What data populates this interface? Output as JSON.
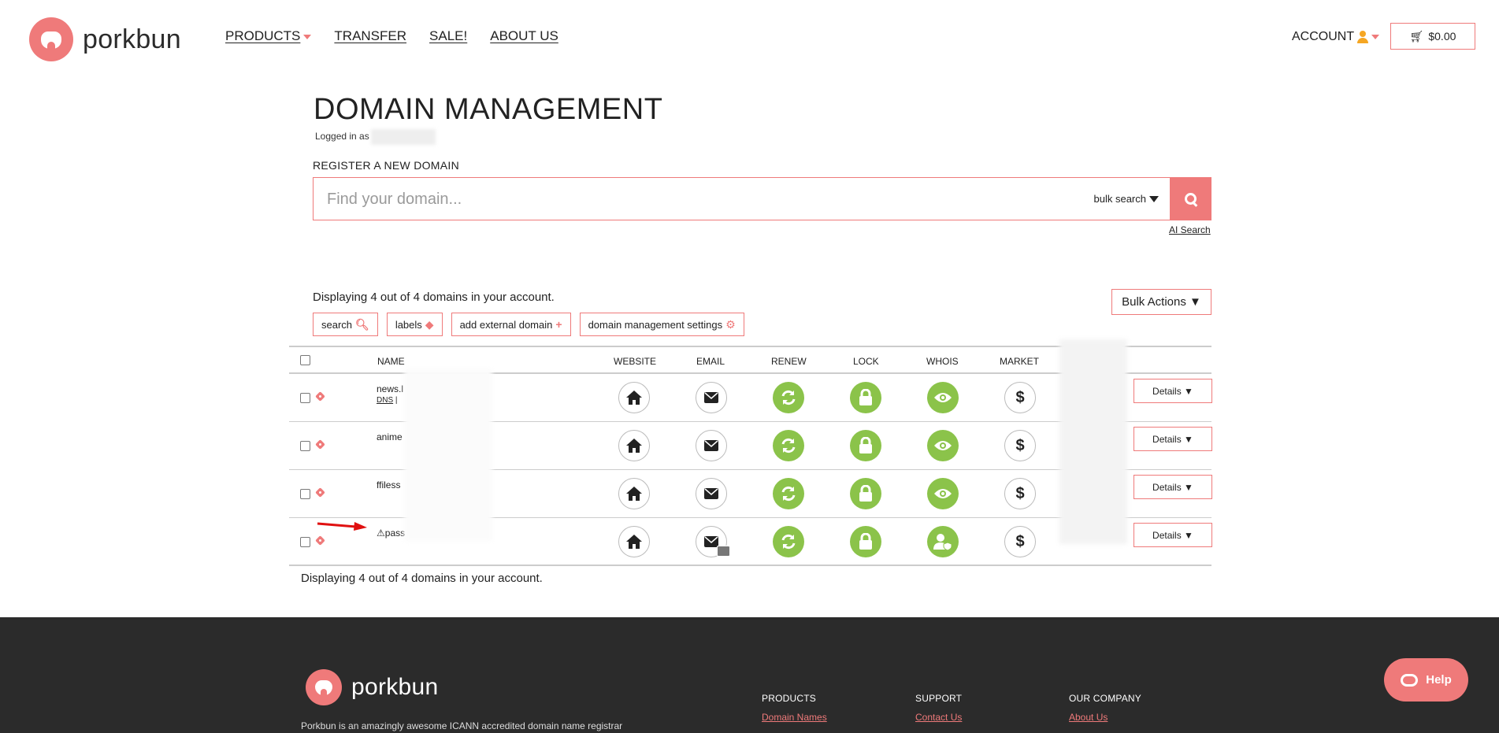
{
  "header": {
    "brand": "porkbun",
    "nav": [
      {
        "label": "PRODUCTS",
        "dropdown": true
      },
      {
        "label": "TRANSFER"
      },
      {
        "label": "SALE!"
      },
      {
        "label": "ABOUT US"
      }
    ],
    "account_label": "ACCOUNT",
    "cart_total": "$0.00"
  },
  "main": {
    "title": "DOMAIN MANAGEMENT",
    "logged_in_label": "Logged in as",
    "register_label": "REGISTER A NEW DOMAIN",
    "search_placeholder": "Find your domain...",
    "bulk_search_label": "bulk search",
    "ai_search_label": "AI Search",
    "display_count": "Displaying 4 out of 4 domains in your account.",
    "bulk_actions_label": "Bulk Actions ▼",
    "tools": {
      "search": "search",
      "labels": "labels",
      "add_external": "add external domain",
      "settings": "domain management settings"
    }
  },
  "table": {
    "headers": {
      "name": "NAME",
      "website": "WEBSITE",
      "email": "EMAIL",
      "renew": "RENEW",
      "lock": "LOCK",
      "whois": "WHOIS",
      "market": "MARKET"
    },
    "rows": [
      {
        "name": "news.l",
        "dns_label": "DNS",
        "whois_icon": "eye-icon",
        "details": "Details ▼"
      },
      {
        "name": "anime",
        "whois_icon": "eye-icon",
        "details": "Details ▼"
      },
      {
        "name": "ffiless",
        "whois_icon": "eye-icon",
        "details": "Details ▼"
      },
      {
        "name": "pass",
        "warning": true,
        "whois_icon": "user-shield-icon",
        "details": "Details ▼"
      }
    ]
  },
  "footer": {
    "brand": "porkbun",
    "description": "Porkbun is an amazingly awesome ICANN accredited domain name registrar",
    "columns": [
      {
        "heading": "PRODUCTS",
        "links": [
          "Domain Names"
        ]
      },
      {
        "heading": "SUPPORT",
        "links": [
          "Contact Us"
        ]
      },
      {
        "heading": "OUR COMPANY",
        "links": [
          "About Us"
        ]
      }
    ]
  },
  "help_label": "Help",
  "colors": {
    "accent": "#ef7a7a",
    "green": "#8bc34a",
    "footer_bg": "#2b2b2b"
  }
}
